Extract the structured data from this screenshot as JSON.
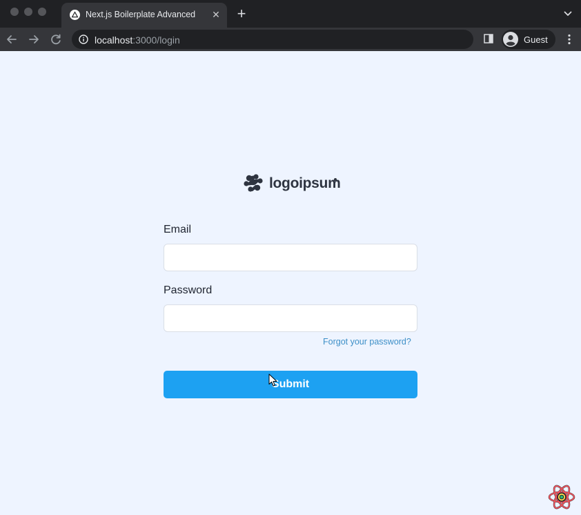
{
  "browser": {
    "tab": {
      "title": "Next.js Boilerplate Advanced",
      "favicon": "vercel-triangle-icon",
      "close_glyph": "✕"
    },
    "new_tab_glyph": "+",
    "address": {
      "host": "localhost",
      "path": ":3000/login"
    },
    "profile": {
      "name": "Guest"
    }
  },
  "page": {
    "logo": {
      "text": "logoipsum"
    },
    "form": {
      "email_label": "Email",
      "email_value": "",
      "password_label": "Password",
      "password_value": "",
      "forgot_link": "Forgot your password?",
      "submit_label": "Submit"
    }
  },
  "colors": {
    "page_background": "#eef4ff",
    "submit_background": "#1da1f2",
    "link": "#3d8fc7",
    "chrome_dark": "#202124",
    "chrome_toolbar": "#35363a"
  }
}
